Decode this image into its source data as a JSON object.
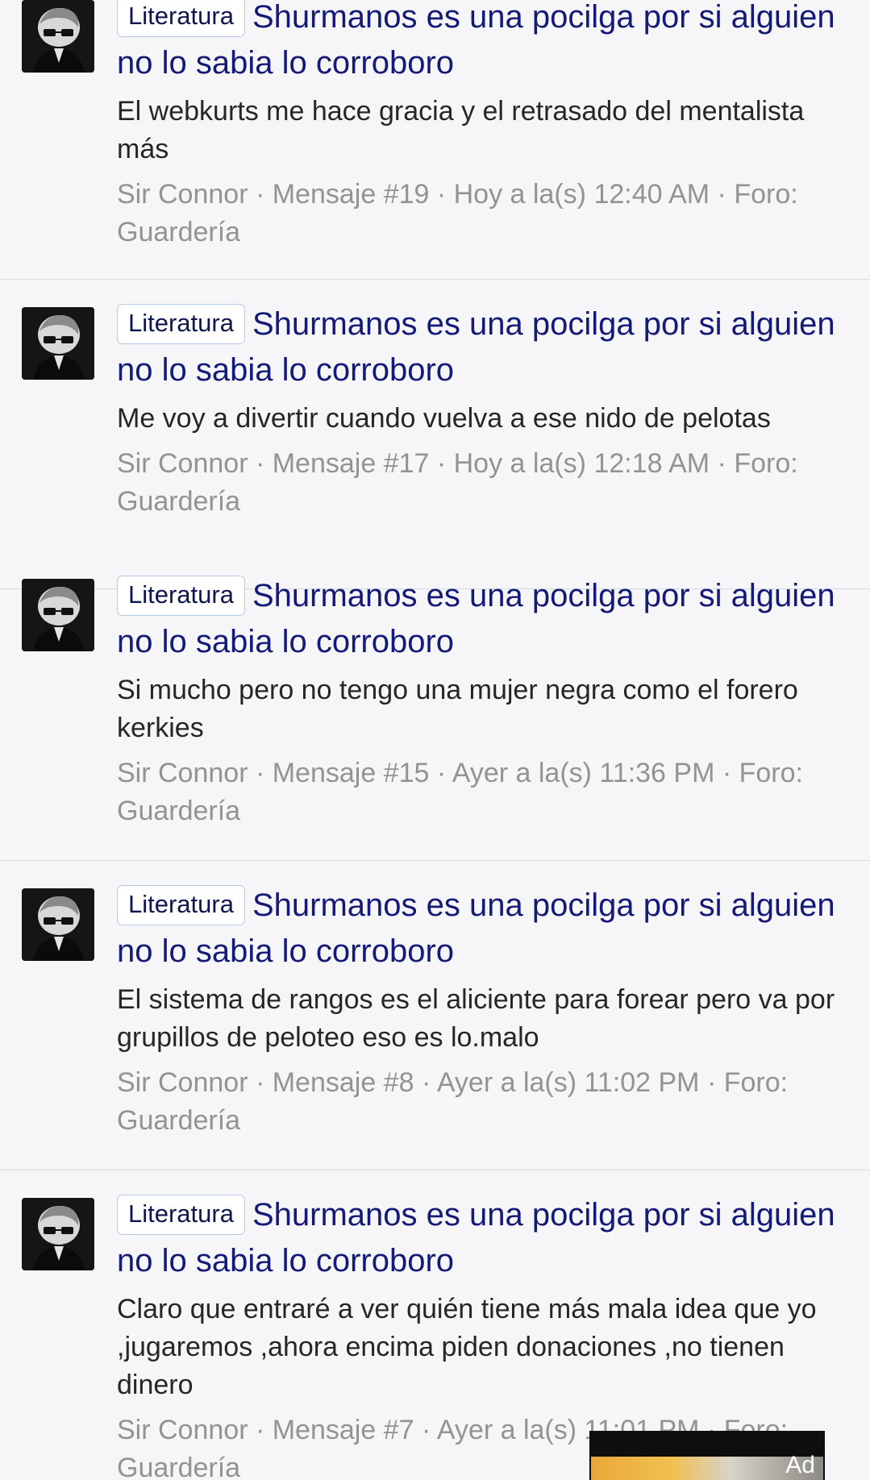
{
  "posts": [
    {
      "tag": "Literatura",
      "title": "Shurmanos es una pocilga por si alguien no lo sabia lo corroboro",
      "body": "El webkurts me hace gracia y el retrasado del mentalista más",
      "meta": "Sir Connor · Mensaje #19 · Hoy a la(s) 12:40 AM · Foro: Guardería"
    },
    {
      "tag": "Literatura",
      "title": "Shurmanos es una pocilga por si alguien no lo sabia lo corroboro",
      "body": "Me voy a divertir cuando vuelva a ese nido de pelotas",
      "meta": "Sir Connor · Mensaje #17 · Hoy a la(s) 12:18 AM · Foro: Guardería"
    },
    {
      "tag": "Literatura",
      "title": "Shurmanos es una pocilga por si alguien no lo sabia lo corroboro",
      "body": "Si mucho pero no tengo una mujer negra como el forero kerkies",
      "meta": "Sir Connor · Mensaje #15 · Ayer a la(s) 11:36 PM · Foro: Guardería"
    },
    {
      "tag": "Literatura",
      "title": "Shurmanos es una pocilga por si alguien no lo sabia lo corroboro",
      "body": "El sistema de rangos es el aliciente para forear pero va por grupillos de peloteo eso es lo.malo",
      "meta": "Sir Connor · Mensaje #8 · Ayer a la(s) 11:02 PM · Foro: Guardería"
    },
    {
      "tag": "Literatura",
      "title": "Shurmanos es una pocilga por si alguien no lo sabia lo corroboro",
      "body": "Claro que entraré a ver quién tiene más mala idea que yo ,jugaremos ,ahora encima piden donaciones ,no tienen dinero",
      "meta": "Sir Connor · Mensaje #7 · Ayer a la(s) 11:01 PM · Foro: Guardería"
    }
  ],
  "ad": {
    "label": "Ad"
  }
}
